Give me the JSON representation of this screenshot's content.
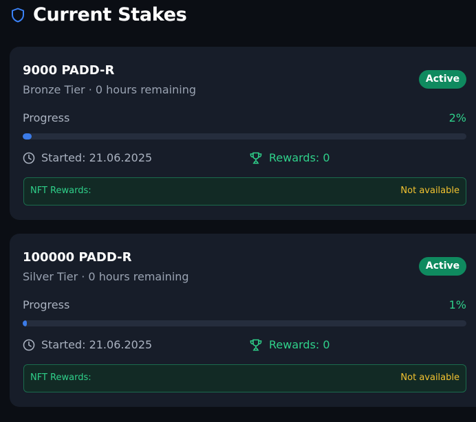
{
  "header": {
    "title": "Current Stakes",
    "icon": "shield-icon",
    "icon_color": "#3b82f6"
  },
  "colors": {
    "accent_green": "#2fd08a",
    "badge_green": "#0f8a5f",
    "progress_blue": "#3b7be8",
    "nft_yellow": "#f2c230"
  },
  "stakes": [
    {
      "amount": "9000 PADD-R",
      "subtitle": "Bronze Tier · 0 hours remaining",
      "status": "Active",
      "progress_label": "Progress",
      "progress_text": "2%",
      "progress_fraction": 0.02,
      "started": "Started: 21.06.2025",
      "rewards": "Rewards: 0",
      "nft_label": "NFT Rewards:",
      "nft_status": "Not available"
    },
    {
      "amount": "100000 PADD-R",
      "subtitle": "Silver Tier · 0 hours remaining",
      "status": "Active",
      "progress_label": "Progress",
      "progress_text": "1%",
      "progress_fraction": 0.01,
      "started": "Started: 21.06.2025",
      "rewards": "Rewards: 0",
      "nft_label": "NFT Rewards:",
      "nft_status": "Not available"
    }
  ]
}
